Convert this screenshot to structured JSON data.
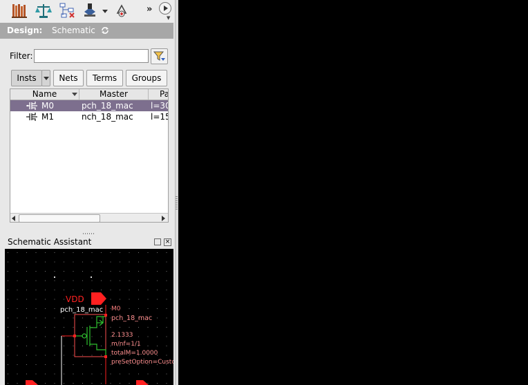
{
  "toolbar": {
    "icons": [
      "library-icon",
      "balance-icon",
      "hierarchy-icon",
      "stamp-icon",
      "recycle-icon"
    ],
    "more_label": "»"
  },
  "design": {
    "label": "Design:",
    "value": "Schematic"
  },
  "filter": {
    "label": "Filter:",
    "value": "",
    "placeholder": ""
  },
  "tabs": [
    {
      "label": "Insts",
      "active": true
    },
    {
      "label": "Nets",
      "active": false
    },
    {
      "label": "Terms",
      "active": false
    },
    {
      "label": "Groups",
      "active": false
    }
  ],
  "table": {
    "columns": [
      "Name",
      "Master",
      "Pa"
    ],
    "rows": [
      {
        "name": "M0",
        "master": "pch_18_mac",
        "params": "l=30",
        "selected": true
      },
      {
        "name": "M1",
        "master": "nch_18_mac",
        "params": "l=15",
        "selected": false
      }
    ]
  },
  "assistant": {
    "title": "Schematic Assistant"
  },
  "schematic": {
    "vdd_label": "VDD",
    "master_label": "pch_18_mac",
    "inst_name": "M0",
    "inst_master": "pch_18_mac",
    "param_w": "2.1333",
    "param_mnf": "m/nf=1/1",
    "param_total": "totalM=1.0000",
    "param_preset": "preSetOption=Custo",
    "colors": {
      "net": "#ff2020",
      "device": "#30c030",
      "label": "#ffffff",
      "param": "#ff9090"
    }
  }
}
